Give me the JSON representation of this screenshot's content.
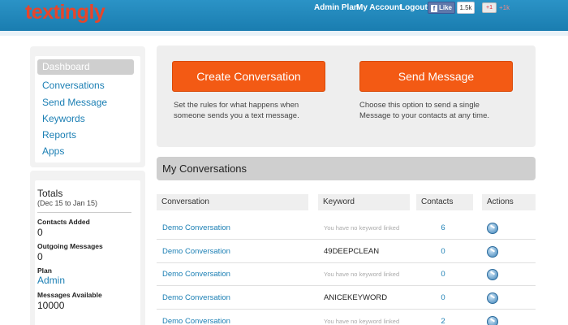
{
  "header": {
    "logo": "textingly",
    "links": [
      "Admin Plan",
      "My Account",
      "Logout"
    ],
    "fb_like_label": "Like",
    "fb_like_count": "1.5k",
    "gplus_label": "+1",
    "gplus_count": "+1k",
    "bg_color": "#1f87bb"
  },
  "sidebar": {
    "nav": [
      {
        "label": "Dashboard",
        "active": true
      },
      {
        "label": "Conversations",
        "active": false
      },
      {
        "label": "Send Message",
        "active": false
      },
      {
        "label": "Keywords",
        "active": false
      },
      {
        "label": "Reports",
        "active": false
      },
      {
        "label": "Apps",
        "active": false
      }
    ],
    "totals": {
      "title": "Totals",
      "range": "(Dec 15 to Jan 15)",
      "stats": [
        {
          "label": "Contacts Added",
          "value": "0"
        },
        {
          "label": "Outgoing Messages",
          "value": "0"
        },
        {
          "label": "Plan",
          "value": "Admin"
        },
        {
          "label": "Messages Available",
          "value": "10000"
        }
      ]
    }
  },
  "actions": {
    "create": {
      "label": "Create Conversation",
      "description_line1": "Set the rules for what happens when",
      "description_line2": "someone sends you a text message."
    },
    "send": {
      "label": "Send Message",
      "description_line1": "Choose this option to send a single",
      "description_line2": "Message to your contacts at any time."
    },
    "accent_color": "#f35a14"
  },
  "conversations": {
    "title": "My Conversations",
    "columns": [
      "Conversation",
      "Keyword",
      "Contacts",
      "Actions"
    ],
    "rows": [
      {
        "name": "Demo Conversation",
        "keyword": "You have no keyword linked",
        "keyword_empty": true,
        "contacts": "6",
        "action_icon": "search-icon"
      },
      {
        "name": "Demo Conversation",
        "keyword": "49DEEPCLEAN",
        "keyword_empty": false,
        "contacts": "0",
        "action_icon": "search-icon"
      },
      {
        "name": "Demo Conversation",
        "keyword": "You have no keyword linked",
        "keyword_empty": true,
        "contacts": "0",
        "action_icon": "search-icon"
      },
      {
        "name": "Demo Conversation",
        "keyword": "ANICEKEYWORD",
        "keyword_empty": false,
        "contacts": "0",
        "action_icon": "search-icon"
      },
      {
        "name": "Demo Conversation",
        "keyword": "You have no keyword linked",
        "keyword_empty": true,
        "contacts": "2",
        "action_icon": "search-icon"
      }
    ]
  }
}
